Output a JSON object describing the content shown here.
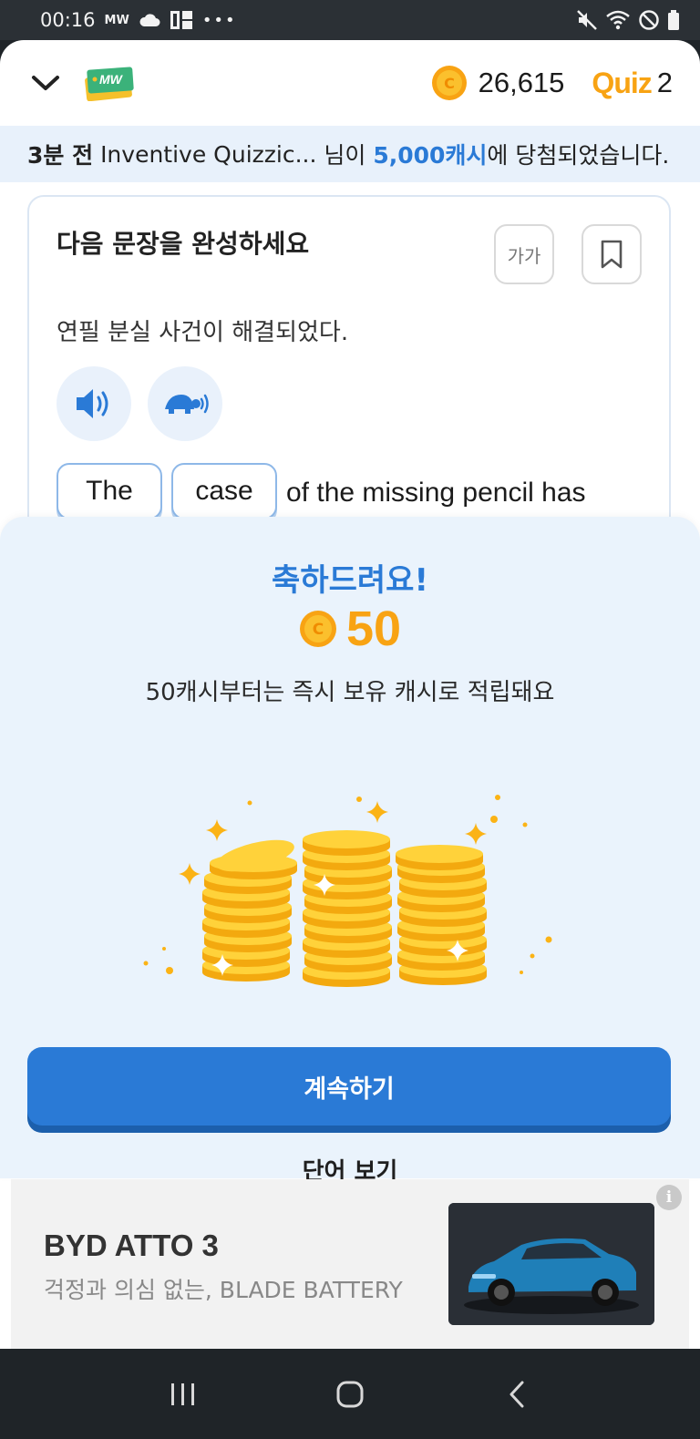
{
  "status_bar": {
    "time": "00:16",
    "notif_label": "MW"
  },
  "header": {
    "logo_text": "MW",
    "coin_count": "26,615",
    "quiz_label": "Quiz",
    "quiz_count": "2"
  },
  "ticker": {
    "time_ago": "3분 전",
    "user": "Inventive Quizzic...",
    "mid": "님이",
    "prize": "5,000캐시",
    "suffix": "에 당첨되었습니다."
  },
  "quiz_card": {
    "title": "다음 문장을 완성하세요",
    "font_size_label": "가가",
    "sentence_ko": "연필 분실 사건이 해결되었다.",
    "word_chips": [
      "The",
      "case"
    ],
    "sentence_en_rest": "of the missing pencil has"
  },
  "reward_sheet": {
    "congrats": "축하드려요!",
    "amount": "50",
    "description": "50캐시부터는 즉시 보유 캐시로 적립돼요",
    "continue_label": "계속하기",
    "word_view_label": "단어 보기"
  },
  "ad": {
    "title": "BYD ATTO 3",
    "subtitle": "걱정과 의심 없는, BLADE BATTERY",
    "info_label": "i"
  },
  "colors": {
    "accent_blue": "#2a7ad6",
    "coin_gold": "#f8a313",
    "sheet_bg": "#eaf3fc"
  }
}
